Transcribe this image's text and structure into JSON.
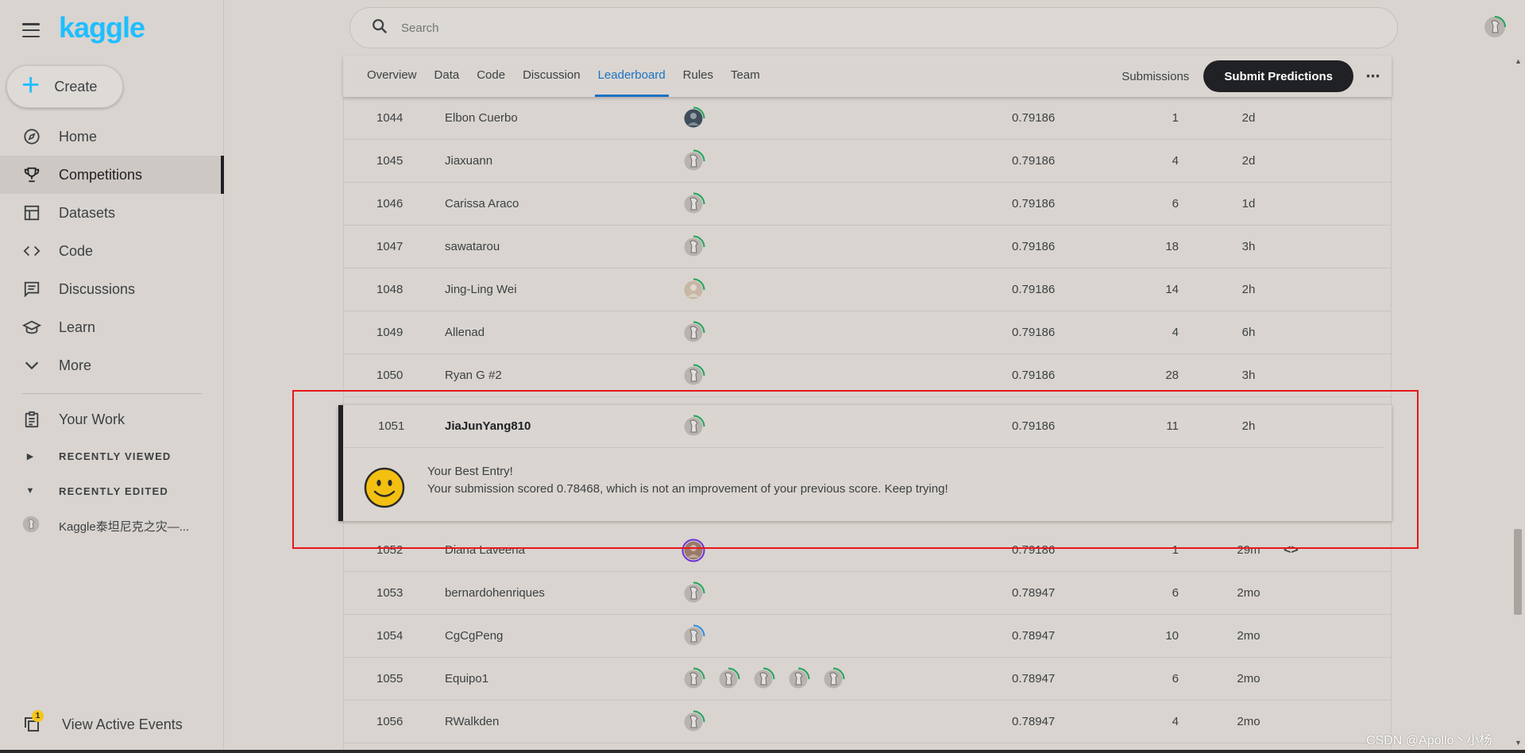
{
  "app": {
    "logo": "kaggle"
  },
  "sidebar": {
    "create_label": "Create",
    "items": [
      {
        "label": "Home",
        "icon": "compass-icon"
      },
      {
        "label": "Competitions",
        "icon": "trophy-icon",
        "active": true
      },
      {
        "label": "Datasets",
        "icon": "table-icon"
      },
      {
        "label": "Code",
        "icon": "code-icon"
      },
      {
        "label": "Discussions",
        "icon": "comments-icon"
      },
      {
        "label": "Learn",
        "icon": "school-icon"
      },
      {
        "label": "More",
        "icon": "chevron-down-icon"
      }
    ],
    "your_work": "Your Work",
    "recently_viewed": "RECENTLY VIEWED",
    "recently_edited": "RECENTLY EDITED",
    "recent_file": "Kaggle泰坦尼克之灾—...",
    "view_active_events": "View Active Events",
    "events_badge": "1"
  },
  "search": {
    "placeholder": "Search"
  },
  "tabs": [
    "Overview",
    "Data",
    "Code",
    "Discussion",
    "Leaderboard",
    "Rules",
    "Team"
  ],
  "active_tab": "Leaderboard",
  "header_actions": {
    "submissions": "Submissions",
    "submit": "Submit Predictions",
    "more": "⋯"
  },
  "leaderboard": {
    "rows_before": [
      {
        "rank": "1044",
        "name": "Elbon Cuerbo",
        "score": "0.79186",
        "entries": "1",
        "last": "2d"
      },
      {
        "rank": "1045",
        "name": "Jiaxuann",
        "score": "0.79186",
        "entries": "4",
        "last": "2d"
      },
      {
        "rank": "1046",
        "name": "Carissa Araco",
        "score": "0.79186",
        "entries": "6",
        "last": "1d"
      },
      {
        "rank": "1047",
        "name": "sawatarou",
        "score": "0.79186",
        "entries": "18",
        "last": "3h"
      },
      {
        "rank": "1048",
        "name": "Jing-Ling Wei",
        "score": "0.79186",
        "entries": "14",
        "last": "2h"
      },
      {
        "rank": "1049",
        "name": "Allenad",
        "score": "0.79186",
        "entries": "4",
        "last": "6h"
      },
      {
        "rank": "1050",
        "name": "Ryan G #2",
        "score": "0.79186",
        "entries": "28",
        "last": "3h"
      }
    ],
    "my_entry": {
      "rank": "1051",
      "name": "JiaJunYang810",
      "score": "0.79186",
      "entries": "11",
      "last": "2h",
      "title": "Your Best Entry!",
      "message": "Your submission scored 0.78468, which is not an improvement of your previous score. Keep trying!"
    },
    "rows_after": [
      {
        "rank": "1052",
        "name": "Diana Laveena",
        "score": "0.79186",
        "entries": "1",
        "last": "29m",
        "code": "<>"
      },
      {
        "rank": "1053",
        "name": "bernardohenriques",
        "score": "0.78947",
        "entries": "6",
        "last": "2mo"
      },
      {
        "rank": "1054",
        "name": "CgCgPeng",
        "score": "0.78947",
        "entries": "10",
        "last": "2mo"
      },
      {
        "rank": "1055",
        "name": "Equipo1",
        "score": "0.78947",
        "entries": "6",
        "last": "2mo"
      },
      {
        "rank": "1056",
        "name": "RWalkden",
        "score": "0.78947",
        "entries": "4",
        "last": "2mo"
      }
    ]
  },
  "watermark": "CSDN @Apollo丶小杨",
  "colors": {
    "accent": "#20beff",
    "tab_active": "#1a73c4",
    "highlight": "#e8161c"
  }
}
